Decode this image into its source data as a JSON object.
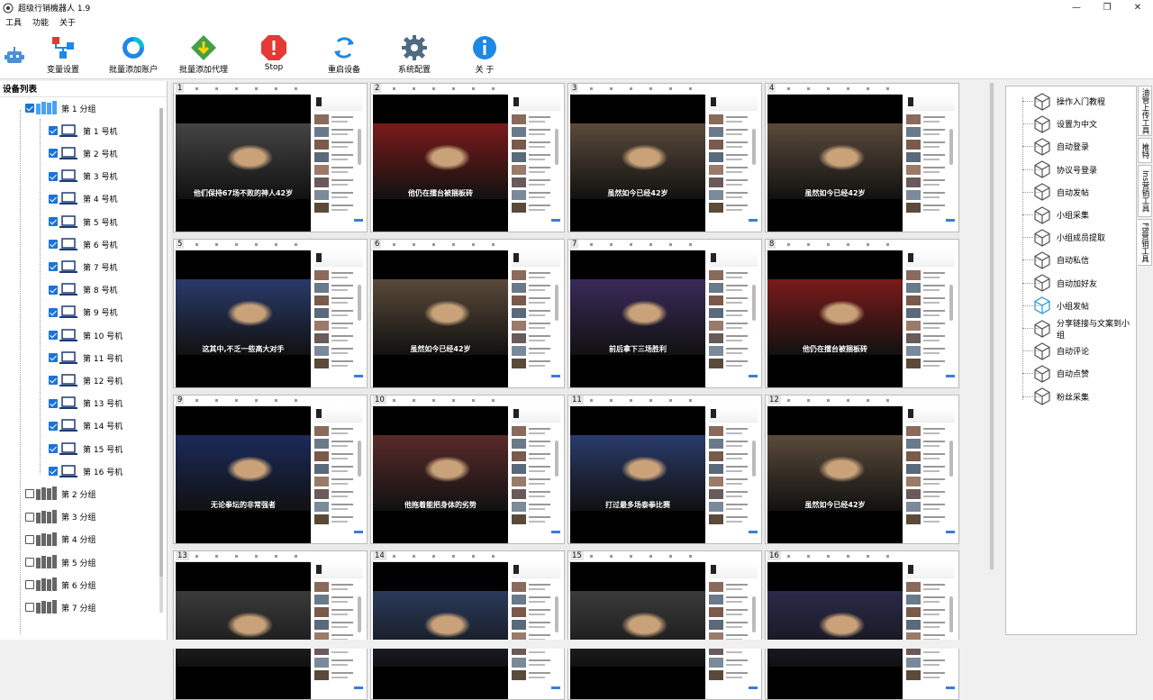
{
  "window": {
    "title": "超级行销機器人 1.9",
    "minimize": "—",
    "restore": "❐",
    "close": "✕"
  },
  "menu": [
    "工具",
    "功能",
    "关于"
  ],
  "toolbar": [
    {
      "label": "变量设置",
      "icon": "variable-settings-icon"
    },
    {
      "label": "批量添加账户",
      "icon": "add-accounts-icon"
    },
    {
      "label": "批量添加代理",
      "icon": "add-proxy-icon"
    },
    {
      "label": "Stop",
      "icon": "stop-icon"
    },
    {
      "label": "重启设备",
      "icon": "restart-icon"
    },
    {
      "label": "系统配置",
      "icon": "gear-icon"
    },
    {
      "label": "关 于",
      "icon": "info-icon"
    }
  ],
  "device_panel": {
    "title": "设备列表",
    "groups": [
      {
        "label": "第 1 分组",
        "checked": true,
        "devices": [
          "第 1 号机",
          "第 2 号机",
          "第 3 号机",
          "第 4 号机",
          "第 5 号机",
          "第 6 号机",
          "第 7 号机",
          "第 8 号机",
          "第 9 号机",
          "第 10 号机",
          "第 11 号机",
          "第 12 号机",
          "第 13 号机",
          "第 14 号机",
          "第 15 号机",
          "第 16 号机"
        ]
      },
      {
        "label": "第 2 分组",
        "checked": false
      },
      {
        "label": "第 3 分组",
        "checked": false
      },
      {
        "label": "第 4 分组",
        "checked": false
      },
      {
        "label": "第 5 分组",
        "checked": false
      },
      {
        "label": "第 6 分组",
        "checked": false
      },
      {
        "label": "第 7 分组",
        "checked": false
      }
    ]
  },
  "screens": [
    {
      "num": "1",
      "subtitle": "他们保持67场不败的神人42岁",
      "bg": "#444"
    },
    {
      "num": "2",
      "subtitle": "他仍在擂台被捆板砖",
      "bg": "#7a1a1a"
    },
    {
      "num": "3",
      "subtitle": "虽然如今已经42岁",
      "bg": "#5a4a3a"
    },
    {
      "num": "4",
      "subtitle": "虽然如今已经42岁",
      "bg": "#5a4a3a"
    },
    {
      "num": "5",
      "subtitle": "这其中,不乏一些高大对手",
      "bg": "#2a3a6a"
    },
    {
      "num": "6",
      "subtitle": "虽然如今已经42岁",
      "bg": "#5a4a3a"
    },
    {
      "num": "7",
      "subtitle": "前后拿下三场胜利",
      "bg": "#3a2a5a"
    },
    {
      "num": "8",
      "subtitle": "他仍在擂台被捆板砖",
      "bg": "#7a1a1a"
    },
    {
      "num": "9",
      "subtitle": "无论拳坛的非常强者",
      "bg": "#1a2a5a"
    },
    {
      "num": "10",
      "subtitle": "他拖着能把身体的劣势",
      "bg": "#5a2a2a"
    },
    {
      "num": "11",
      "subtitle": "打过最多场泰拳比赛",
      "bg": "#2a3a6a"
    },
    {
      "num": "12",
      "subtitle": "虽然如今已经42岁",
      "bg": "#5a4a3a"
    },
    {
      "num": "13",
      "subtitle": "",
      "bg": "#3a3a3a"
    },
    {
      "num": "14",
      "subtitle": "",
      "bg": "#2a3a5a"
    },
    {
      "num": "15",
      "subtitle": "",
      "bg": "#3a3a3a"
    },
    {
      "num": "16",
      "subtitle": "",
      "bg": "#2a2a4a"
    }
  ],
  "functions": [
    "操作入门教程",
    "设置为中文",
    "自动登录",
    "协议号登录",
    "自动发帖",
    "小组采集",
    "小组成员提取",
    "自动私信",
    "自动加好友",
    "小组发帖",
    "分享链接与文案到小组",
    "自动评论",
    "自动点赞",
    "粉丝采集"
  ],
  "active_function": "小组发帖",
  "side_tabs": [
    "油管上传工具",
    "推特",
    "Ins营销工具",
    "FB营销工具"
  ],
  "colors": {
    "checkbox": "#1a73d9",
    "stop": "#e53935",
    "proxy": "#43a047",
    "info": "#1e88e5"
  }
}
